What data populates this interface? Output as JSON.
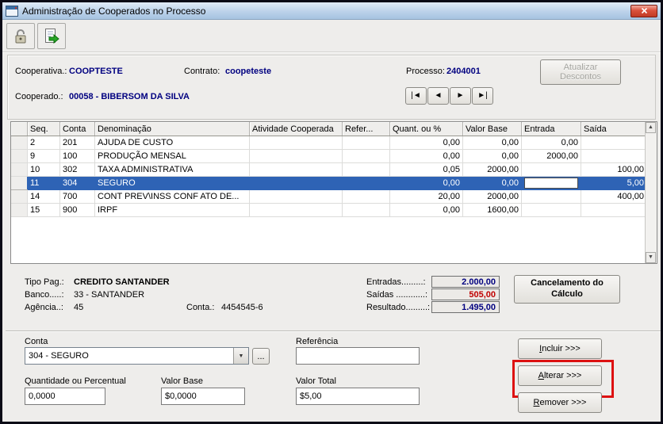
{
  "window": {
    "title": "Administração de Cooperados no Processo"
  },
  "icons": {
    "nav_first": "|◄",
    "nav_prev": "◄",
    "nav_next": "►",
    "nav_last": "►|",
    "scroll_up": "▲",
    "scroll_down": "▼",
    "combo_arrow": "▼"
  },
  "header": {
    "cooperativa_label": "Cooperativa.:",
    "cooperativa_value": "COOPTESTE",
    "contrato_label": "Contrato:",
    "contrato_value": "coopeteste",
    "processo_label": "Processo:",
    "processo_value": "2404001",
    "cooperado_label": "Cooperado.:",
    "cooperado_value": "00058 - BIBERSOM DA SILVA",
    "atualizar_descontos_label": "Atualizar Descontos"
  },
  "grid": {
    "columns": [
      "Seq.",
      "Conta",
      "Denominação",
      "Atividade Cooperada",
      "Refer...",
      "Quant. ou %",
      "Valor Base",
      "Entrada",
      "Saída"
    ],
    "numeric_columns": [
      5,
      6,
      7,
      8
    ],
    "rows": [
      {
        "cells": [
          "2",
          "201",
          "AJUDA DE CUSTO",
          "",
          "",
          "0,00",
          "0,00",
          "0,00",
          ""
        ],
        "selected": false
      },
      {
        "cells": [
          "9",
          "100",
          "PRODUÇÃO MENSAL",
          "",
          "",
          "0,00",
          "0,00",
          "2000,00",
          ""
        ],
        "selected": false
      },
      {
        "cells": [
          "10",
          "302",
          "TAXA ADMINISTRATIVA",
          "",
          "",
          "0,05",
          "2000,00",
          "",
          "100,00"
        ],
        "selected": false
      },
      {
        "cells": [
          "11",
          "304",
          "SEGURO",
          "",
          "",
          "0,00",
          "0,00",
          "",
          "5,00"
        ],
        "selected": true,
        "editor_col": 7
      },
      {
        "cells": [
          "14",
          "700",
          "CONT PREV\\INSS CONF ATO DE...",
          "",
          "",
          "20,00",
          "2000,00",
          "",
          "400,00"
        ],
        "selected": false
      },
      {
        "cells": [
          "15",
          "900",
          "IRPF",
          "",
          "",
          "0,00",
          "1600,00",
          "",
          ""
        ],
        "selected": false
      }
    ]
  },
  "payment": {
    "tipo_pag_label": "Tipo Pag.:",
    "tipo_pag_value": "CREDITO SANTANDER",
    "banco_label": "Banco.....:",
    "banco_value": "33 - SANTANDER",
    "agencia_label": "Agência..:",
    "agencia_value": "45",
    "conta_label": "Conta.:",
    "conta_value": "4454545-6",
    "entradas_label": "Entradas.........:",
    "entradas_value": "2.000,00",
    "saidas_label": "Saídas ............:",
    "saidas_value": "505,00",
    "resultado_label": "Resultado.........:",
    "resultado_value": "1.495,00",
    "cancelamento_button": "Cancelamento do Cálculo"
  },
  "form": {
    "conta_label": "Conta",
    "conta_value": "304 - SEGURO",
    "browse_button": "...",
    "referencia_label": "Referência",
    "referencia_value": "",
    "quantidade_label": "Quantidade ou Percentual",
    "quantidade_value": "0,0000",
    "valor_base_label": "Valor Base",
    "valor_base_value": "$0,0000",
    "valor_total_label": "Valor Total",
    "valor_total_value": "$5,00",
    "incluir_button": "Incluir >>>",
    "alterar_button": "Alterar >>>",
    "remover_button": "Remover >>>"
  },
  "colors": {
    "value_navy": "#000080",
    "negative_red": "#c00000",
    "selection_blue": "#2e63b5",
    "annotation_red": "#dd1111"
  }
}
